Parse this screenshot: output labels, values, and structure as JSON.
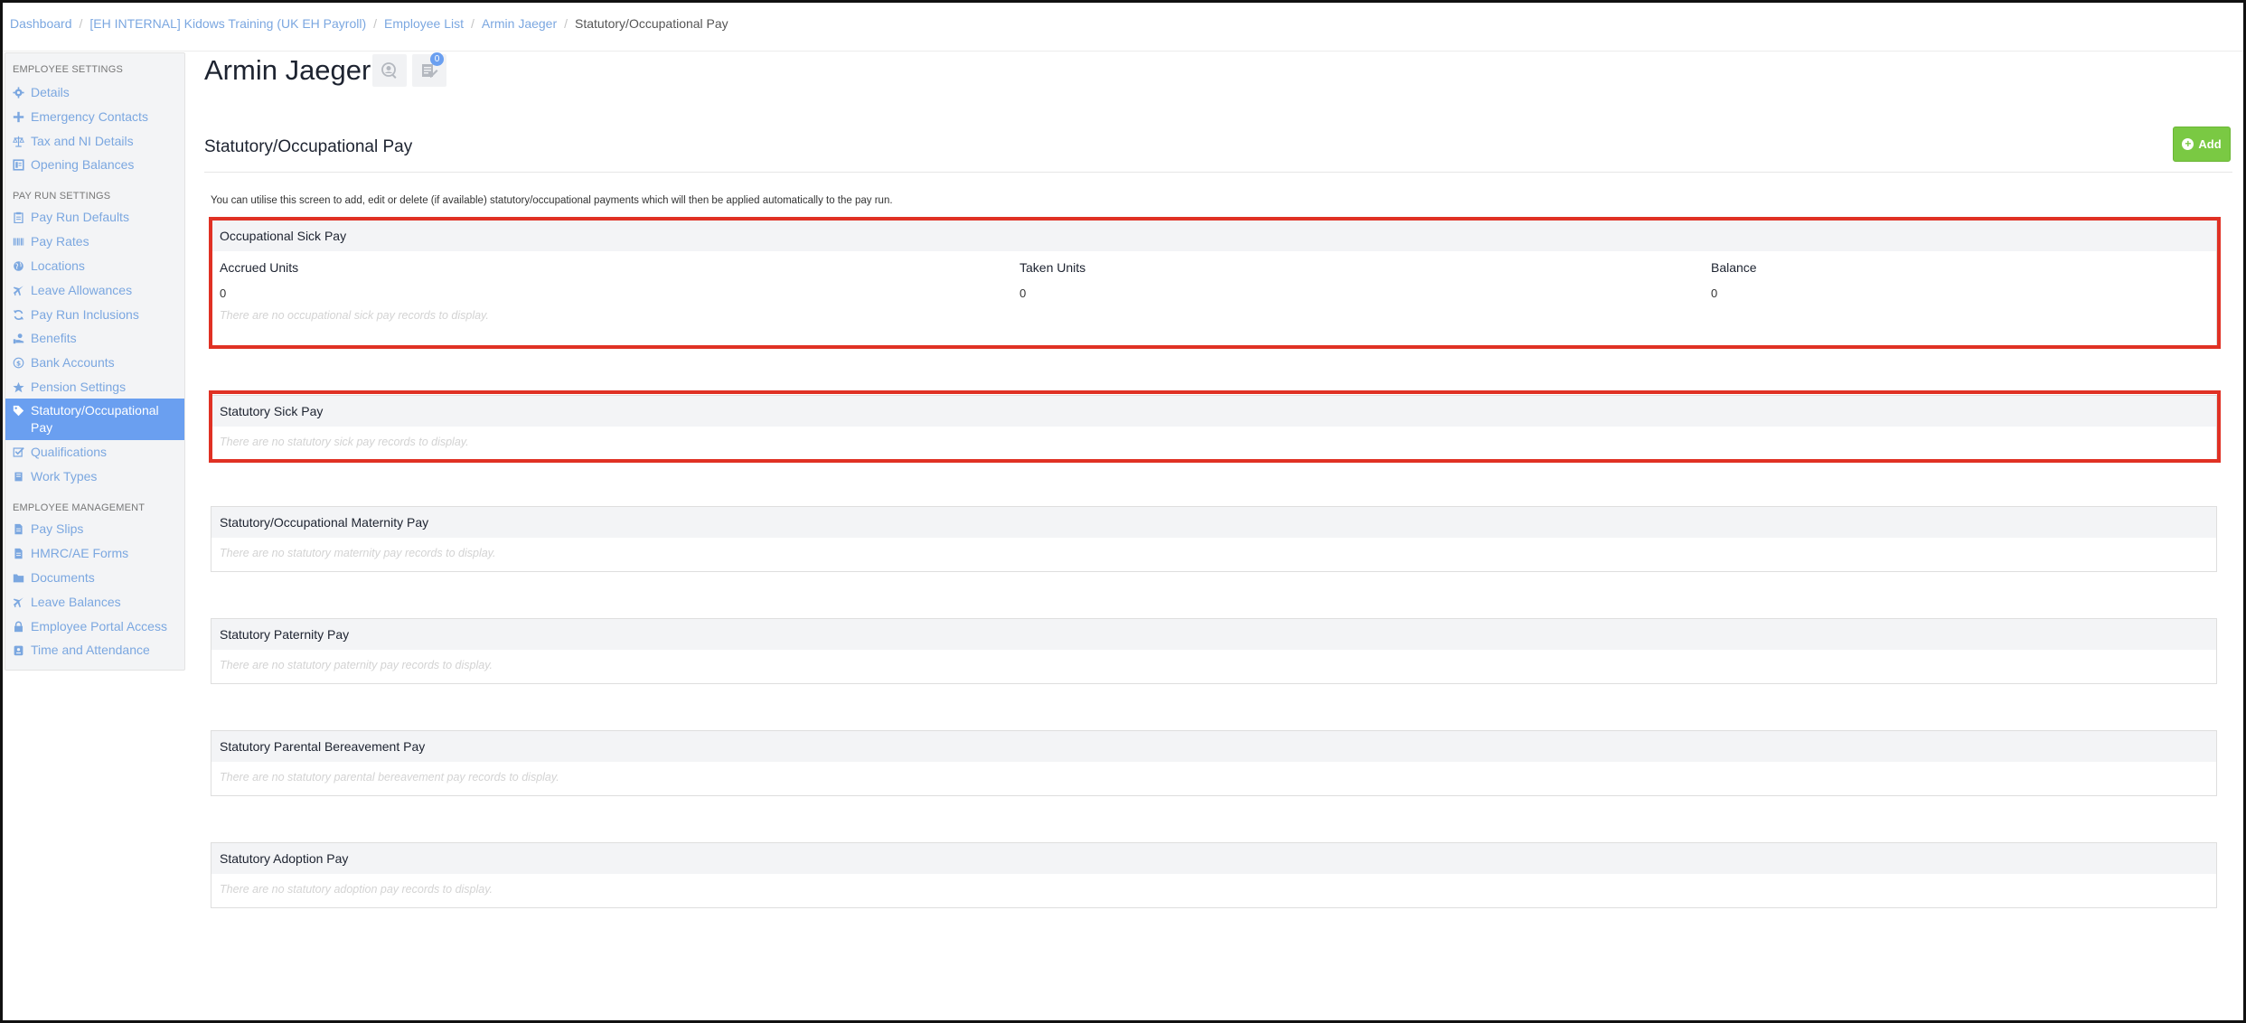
{
  "breadcrumb": {
    "items": [
      "Dashboard",
      "[EH INTERNAL] Kidows Training (UK EH Payroll)",
      "Employee List",
      "Armin Jaeger"
    ],
    "current": "Statutory/Occupational Pay",
    "separator": "/"
  },
  "sidebar": {
    "sections": [
      {
        "title": "EMPLOYEE SETTINGS"
      },
      {
        "title": "PAY RUN SETTINGS"
      },
      {
        "title": "EMPLOYEE MANAGEMENT"
      }
    ],
    "items": [
      {
        "label": "Details",
        "icon": "gear-icon"
      },
      {
        "label": "Emergency Contacts",
        "icon": "plus-icon"
      },
      {
        "label": "Tax and NI Details",
        "icon": "scales-icon"
      },
      {
        "label": "Opening Balances",
        "icon": "ledger-icon"
      },
      {
        "label": "Pay Run Defaults",
        "icon": "clipboard-icon"
      },
      {
        "label": "Pay Rates",
        "icon": "barcode-icon"
      },
      {
        "label": "Locations",
        "icon": "globe-icon"
      },
      {
        "label": "Leave Allowances",
        "icon": "plane-icon"
      },
      {
        "label": "Pay Run Inclusions",
        "icon": "refresh-icon"
      },
      {
        "label": "Benefits",
        "icon": "hand-coin-icon"
      },
      {
        "label": "Bank Accounts",
        "icon": "dollar-circle-icon"
      },
      {
        "label": "Pension Settings",
        "icon": "star-icon"
      },
      {
        "label": "Statutory/Occupational Pay",
        "icon": "tag-icon"
      },
      {
        "label": "Qualifications",
        "icon": "checkbox-icon"
      },
      {
        "label": "Work Types",
        "icon": "book-icon"
      },
      {
        "label": "Pay Slips",
        "icon": "document-icon"
      },
      {
        "label": "HMRC/AE Forms",
        "icon": "document-icon"
      },
      {
        "label": "Documents",
        "icon": "folder-icon"
      },
      {
        "label": "Leave Balances",
        "icon": "plane-icon"
      },
      {
        "label": "Employee Portal Access",
        "icon": "lock-icon"
      },
      {
        "label": "Time and Attendance",
        "icon": "time-card-icon"
      }
    ]
  },
  "header": {
    "employee_name": "Armin Jaeger",
    "notes_badge": "0"
  },
  "page": {
    "title": "Statutory/Occupational Pay",
    "add_label": "Add",
    "intro": "You can utilise this screen to add, edit or delete (if available) statutory/occupational payments which will then be applied automatically to the pay run."
  },
  "occupational_sick_pay": {
    "title": "Occupational Sick Pay",
    "columns": [
      {
        "label": "Accrued Units",
        "value": "0"
      },
      {
        "label": "Taken Units",
        "value": "0"
      },
      {
        "label": "Balance",
        "value": "0"
      }
    ],
    "empty": "There are no occupational sick pay records to display."
  },
  "panels": [
    {
      "title": "Statutory Sick Pay",
      "empty": "There are no statutory sick pay records to display."
    },
    {
      "title": "Statutory/Occupational Maternity Pay",
      "empty": "There are no statutory maternity pay records to display."
    },
    {
      "title": "Statutory Paternity Pay",
      "empty": "There are no statutory paternity pay records to display."
    },
    {
      "title": "Statutory Parental Bereavement Pay",
      "empty": "There are no statutory parental bereavement pay records to display."
    },
    {
      "title": "Statutory Adoption Pay",
      "empty": "There are no statutory adoption pay records to display."
    }
  ],
  "colors": {
    "link": "#7ba7e0",
    "active_nav": "#6a9ff0",
    "add_button": "#7ac943",
    "highlight": "#e03124"
  }
}
